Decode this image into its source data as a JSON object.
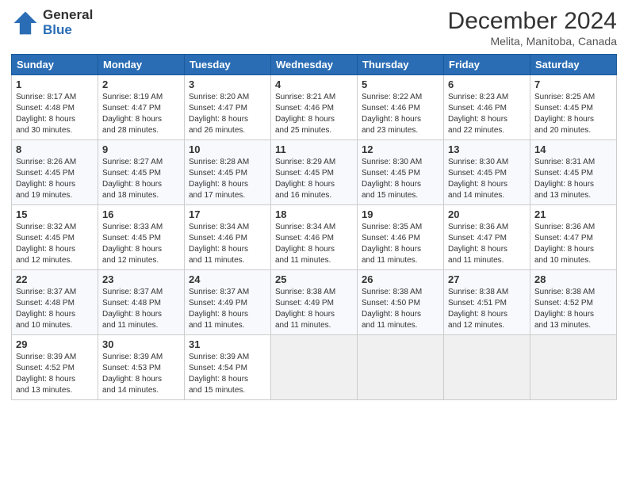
{
  "header": {
    "logo_general": "General",
    "logo_blue": "Blue",
    "month": "December 2024",
    "location": "Melita, Manitoba, Canada"
  },
  "weekdays": [
    "Sunday",
    "Monday",
    "Tuesday",
    "Wednesday",
    "Thursday",
    "Friday",
    "Saturday"
  ],
  "weeks": [
    [
      {
        "day": "1",
        "info": "Sunrise: 8:17 AM\nSunset: 4:48 PM\nDaylight: 8 hours\nand 30 minutes."
      },
      {
        "day": "2",
        "info": "Sunrise: 8:19 AM\nSunset: 4:47 PM\nDaylight: 8 hours\nand 28 minutes."
      },
      {
        "day": "3",
        "info": "Sunrise: 8:20 AM\nSunset: 4:47 PM\nDaylight: 8 hours\nand 26 minutes."
      },
      {
        "day": "4",
        "info": "Sunrise: 8:21 AM\nSunset: 4:46 PM\nDaylight: 8 hours\nand 25 minutes."
      },
      {
        "day": "5",
        "info": "Sunrise: 8:22 AM\nSunset: 4:46 PM\nDaylight: 8 hours\nand 23 minutes."
      },
      {
        "day": "6",
        "info": "Sunrise: 8:23 AM\nSunset: 4:46 PM\nDaylight: 8 hours\nand 22 minutes."
      },
      {
        "day": "7",
        "info": "Sunrise: 8:25 AM\nSunset: 4:45 PM\nDaylight: 8 hours\nand 20 minutes."
      }
    ],
    [
      {
        "day": "8",
        "info": "Sunrise: 8:26 AM\nSunset: 4:45 PM\nDaylight: 8 hours\nand 19 minutes."
      },
      {
        "day": "9",
        "info": "Sunrise: 8:27 AM\nSunset: 4:45 PM\nDaylight: 8 hours\nand 18 minutes."
      },
      {
        "day": "10",
        "info": "Sunrise: 8:28 AM\nSunset: 4:45 PM\nDaylight: 8 hours\nand 17 minutes."
      },
      {
        "day": "11",
        "info": "Sunrise: 8:29 AM\nSunset: 4:45 PM\nDaylight: 8 hours\nand 16 minutes."
      },
      {
        "day": "12",
        "info": "Sunrise: 8:30 AM\nSunset: 4:45 PM\nDaylight: 8 hours\nand 15 minutes."
      },
      {
        "day": "13",
        "info": "Sunrise: 8:30 AM\nSunset: 4:45 PM\nDaylight: 8 hours\nand 14 minutes."
      },
      {
        "day": "14",
        "info": "Sunrise: 8:31 AM\nSunset: 4:45 PM\nDaylight: 8 hours\nand 13 minutes."
      }
    ],
    [
      {
        "day": "15",
        "info": "Sunrise: 8:32 AM\nSunset: 4:45 PM\nDaylight: 8 hours\nand 12 minutes."
      },
      {
        "day": "16",
        "info": "Sunrise: 8:33 AM\nSunset: 4:45 PM\nDaylight: 8 hours\nand 12 minutes."
      },
      {
        "day": "17",
        "info": "Sunrise: 8:34 AM\nSunset: 4:46 PM\nDaylight: 8 hours\nand 11 minutes."
      },
      {
        "day": "18",
        "info": "Sunrise: 8:34 AM\nSunset: 4:46 PM\nDaylight: 8 hours\nand 11 minutes."
      },
      {
        "day": "19",
        "info": "Sunrise: 8:35 AM\nSunset: 4:46 PM\nDaylight: 8 hours\nand 11 minutes."
      },
      {
        "day": "20",
        "info": "Sunrise: 8:36 AM\nSunset: 4:47 PM\nDaylight: 8 hours\nand 11 minutes."
      },
      {
        "day": "21",
        "info": "Sunrise: 8:36 AM\nSunset: 4:47 PM\nDaylight: 8 hours\nand 10 minutes."
      }
    ],
    [
      {
        "day": "22",
        "info": "Sunrise: 8:37 AM\nSunset: 4:48 PM\nDaylight: 8 hours\nand 10 minutes."
      },
      {
        "day": "23",
        "info": "Sunrise: 8:37 AM\nSunset: 4:48 PM\nDaylight: 8 hours\nand 11 minutes."
      },
      {
        "day": "24",
        "info": "Sunrise: 8:37 AM\nSunset: 4:49 PM\nDaylight: 8 hours\nand 11 minutes."
      },
      {
        "day": "25",
        "info": "Sunrise: 8:38 AM\nSunset: 4:49 PM\nDaylight: 8 hours\nand 11 minutes."
      },
      {
        "day": "26",
        "info": "Sunrise: 8:38 AM\nSunset: 4:50 PM\nDaylight: 8 hours\nand 11 minutes."
      },
      {
        "day": "27",
        "info": "Sunrise: 8:38 AM\nSunset: 4:51 PM\nDaylight: 8 hours\nand 12 minutes."
      },
      {
        "day": "28",
        "info": "Sunrise: 8:38 AM\nSunset: 4:52 PM\nDaylight: 8 hours\nand 13 minutes."
      }
    ],
    [
      {
        "day": "29",
        "info": "Sunrise: 8:39 AM\nSunset: 4:52 PM\nDaylight: 8 hours\nand 13 minutes."
      },
      {
        "day": "30",
        "info": "Sunrise: 8:39 AM\nSunset: 4:53 PM\nDaylight: 8 hours\nand 14 minutes."
      },
      {
        "day": "31",
        "info": "Sunrise: 8:39 AM\nSunset: 4:54 PM\nDaylight: 8 hours\nand 15 minutes."
      },
      null,
      null,
      null,
      null
    ]
  ]
}
